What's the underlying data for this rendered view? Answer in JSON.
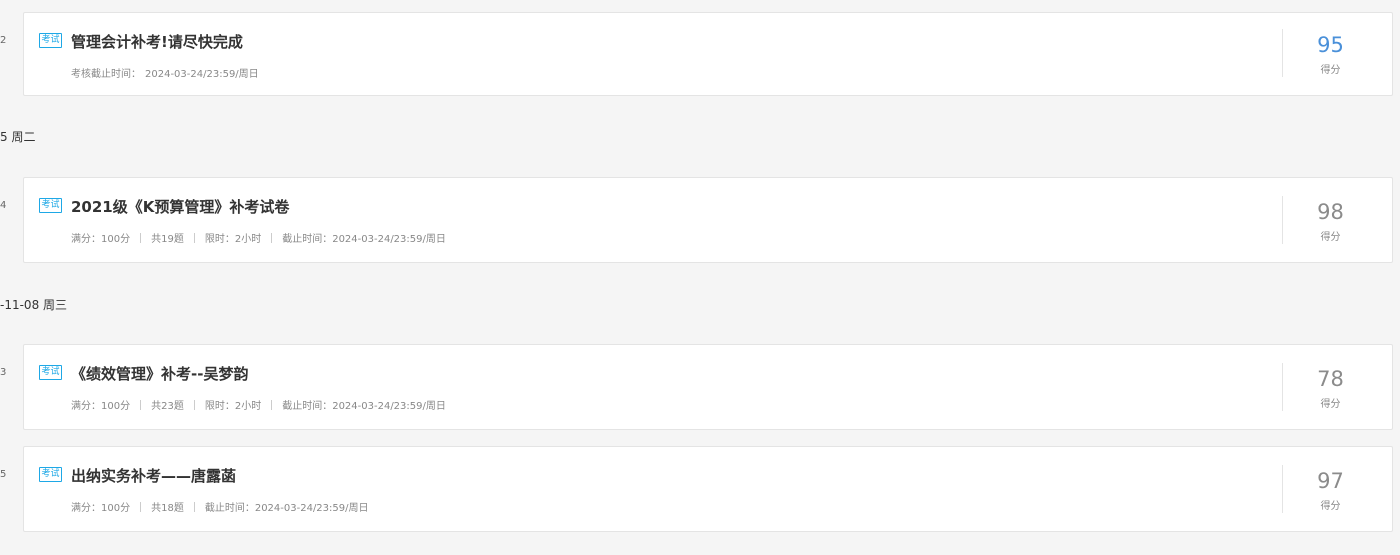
{
  "headers": {
    "h1": "5 周二",
    "h2": "-11-08 周三"
  },
  "side_numbers": {
    "n1": "2",
    "n2": "4",
    "n3": "3",
    "n4": "5"
  },
  "tag_label": "考试",
  "score_label": "得分",
  "items": [
    {
      "title": "管理会计补考!请尽快完成",
      "deadline_label": "考核截止时间：",
      "deadline": "2024-03-24/23:59/周日",
      "score": "95",
      "score_color": "#4a90d9"
    },
    {
      "title": "2021级《K预算管理》补考试卷",
      "full": "满分：100分",
      "count": "共19题",
      "limit": "限时：2小时",
      "deadline": "截止时间：2024-03-24/23:59/周日",
      "score": "98"
    },
    {
      "title": "《绩效管理》补考--吴梦韵",
      "full": "满分：100分",
      "count": "共23题",
      "limit": "限时：2小时",
      "deadline": "截止时间：2024-03-24/23:59/周日",
      "score": "78"
    },
    {
      "title": "出纳实务补考——唐露菡",
      "full": "满分：100分",
      "count": "共18题",
      "deadline": "截止时间：2024-03-24/23:59/周日",
      "score": "97"
    }
  ]
}
